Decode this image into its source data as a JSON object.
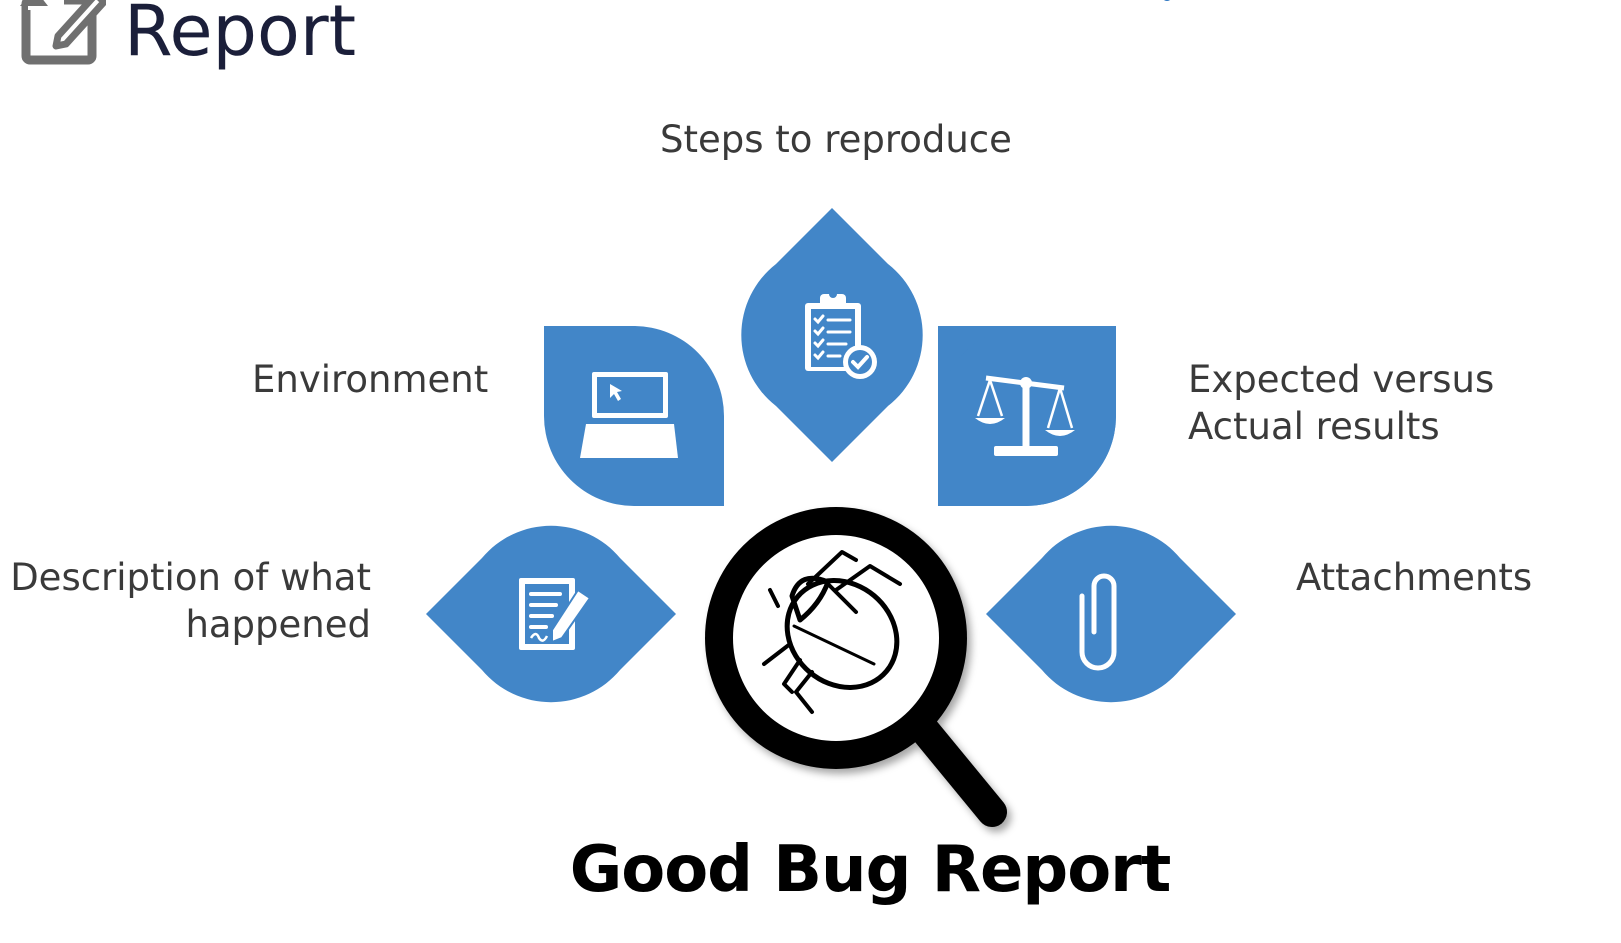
{
  "page": {
    "title": "Report"
  },
  "header_icon": "edit-note-icon",
  "colors": {
    "accent_blue": "#4286c8",
    "title_text": "#1b1f3a",
    "label_text": "#3a3a3a",
    "icon_gray": "#707070"
  },
  "diagram": {
    "center": {
      "icon": "magnifier-bug-icon",
      "caption": "Good Bug Report"
    },
    "petals": [
      {
        "id": "steps",
        "label_lines": [
          "Steps to reproduce"
        ],
        "icon": "clipboard-checklist-icon"
      },
      {
        "id": "environment",
        "label_lines": [
          "Environment"
        ],
        "icon": "laptop-icon"
      },
      {
        "id": "expected",
        "label_lines": [
          "Expected versus",
          "Actual results"
        ],
        "icon": "balance-scale-icon"
      },
      {
        "id": "description",
        "label_lines": [
          "Description of what",
          "happened"
        ],
        "icon": "document-pen-icon"
      },
      {
        "id": "attachments",
        "label_lines": [
          "Attachments"
        ],
        "icon": "paperclip-icon"
      }
    ]
  }
}
